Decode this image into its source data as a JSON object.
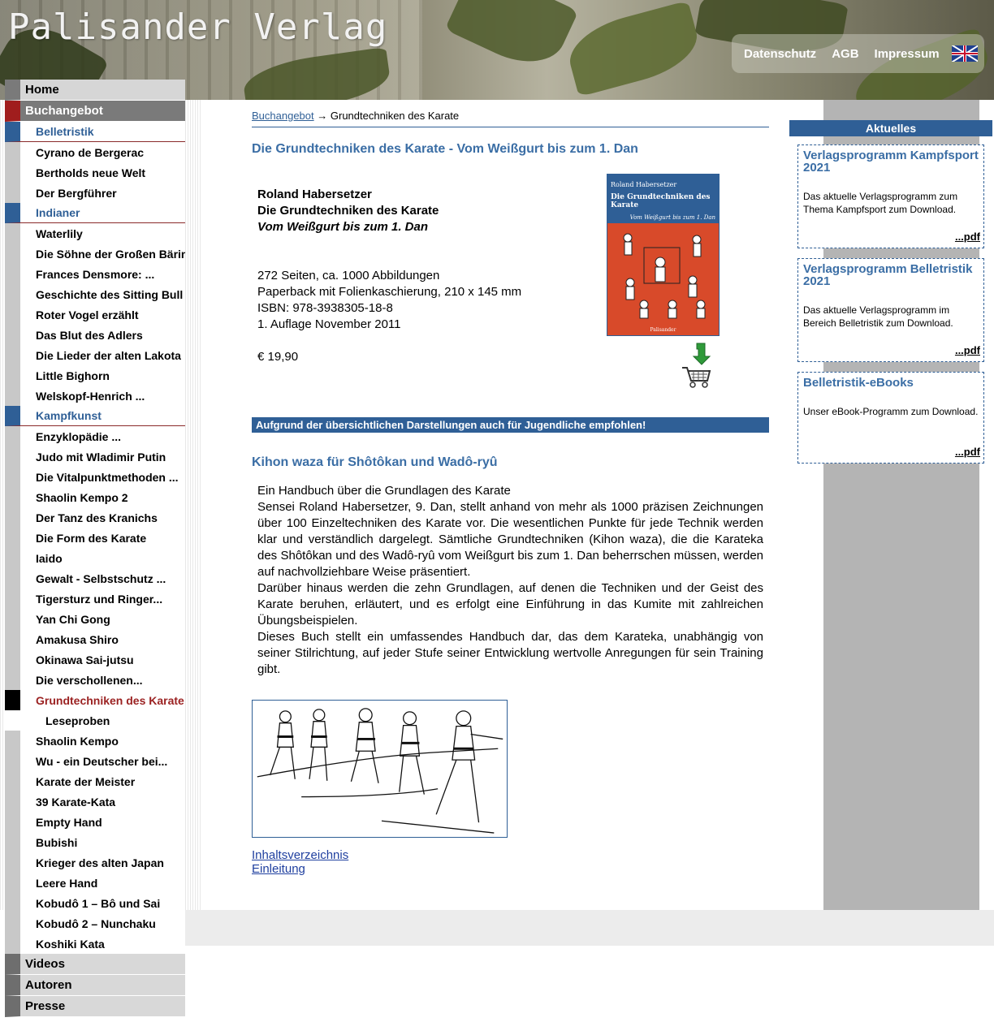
{
  "header": {
    "site_title": "Palisander Verlag",
    "links": [
      "Datenschutz",
      "AGB",
      "Impressum"
    ],
    "language_icon": "uk-flag-icon"
  },
  "nav": {
    "home": "Home",
    "buchangebot": "Buchangebot",
    "categories": {
      "belletristik": {
        "label": "Belletristik",
        "items": [
          "Cyrano de Bergerac",
          "Bertholds neue Welt",
          "Der Bergführer"
        ]
      },
      "indianer": {
        "label": "Indianer",
        "items": [
          "Waterlily",
          "Die Söhne der Großen Bärin",
          "Frances Densmore: ...",
          "Geschichte des Sitting Bull",
          "Roter Vogel erzählt",
          "Das Blut des Adlers",
          "Die Lieder der alten Lakota",
          "Little Bighorn",
          "Welskopf-Henrich ..."
        ]
      },
      "kampfkunst": {
        "label": "Kampfkunst",
        "items_before": [
          "Enzyklopädie ...",
          "Judo mit Wladimir Putin",
          "Die Vitalpunktmethoden ...",
          "Shaolin Kempo 2",
          "Der Tanz des Kranichs",
          "Die Form des Karate",
          "Iaido",
          "Gewalt - Selbstschutz ...",
          "Tigersturz und Ringer...",
          "Yan Chi Gong",
          "Amakusa Shiro",
          "Okinawa Sai-jutsu",
          "Die verschollenen..."
        ],
        "current": "Grundtechniken des Karate",
        "sub": "Leseproben",
        "items_after": [
          "Shaolin Kempo",
          "Wu - ein Deutscher bei...",
          "Karate der Meister",
          "39 Karate-Kata",
          "Empty Hand",
          "Bubishi",
          "Krieger des alten Japan",
          "Leere Hand",
          "Kobudô 1 – Bô und Sai",
          "Kobudô 2 – Nunchaku",
          "Koshiki Kata"
        ]
      }
    },
    "bottom": [
      "Videos",
      "Autoren",
      "Presse"
    ]
  },
  "breadcrumb": {
    "link": "Buchangebot",
    "separator": "→",
    "current": "Grundtechniken des Karate"
  },
  "book": {
    "heading": "Die Grundtechniken des Karate - Vom Weißgurt bis zum 1. Dan",
    "author": "Roland Habersetzer",
    "title": "Die Grundtechniken des Karate",
    "subtitle": "Vom Weißgurt bis zum 1. Dan",
    "pages": "272 Seiten, ca. 1000 Abbildungen",
    "binding": "Paperback mit Folienkaschierung, 210 x 145 mm",
    "isbn": "ISBN: 978-3938305-18-8",
    "edition": "1. Auflage November 2011",
    "price": "€ 19,90",
    "cover_author": "Roland Habersetzer",
    "cover_title": "Die Grundtechniken des Karate",
    "cover_subtitle": "Vom Weißgurt bis zum 1. Dan",
    "cover_publisher": "Palisander"
  },
  "banner": "Aufgrund der übersichtlichen Darstellungen auch für Jugendliche empfohlen!",
  "section_title": "Kihon waza für Shôtôkan und Wadô-ryû",
  "description": [
    "Ein Handbuch über die Grundlagen des Karate",
    "Sensei Roland Habersetzer, 9. Dan, stellt anhand von mehr als 1000 präzisen Zeichnungen über 100 Einzeltechniken des Karate vor. Die wesentlichen Punkte für jede Technik werden klar und verständlich dargelegt. Sämtliche Grundtechniken (Kihon waza), die die Karateka des Shôtôkan und des Wadô-ryû vom Weißgurt bis zum 1. Dan beherrschen müssen, werden auf nachvollziehbare Weise präsentiert.",
    "Darüber hinaus werden die zehn Grundlagen, auf denen die Techniken und der Geist des Karate beruhen, erläutert, und es erfolgt eine Einführung in das Kumite mit zahlreichen Übungsbeispielen.",
    "Dieses Buch stellt ein umfassendes Handbuch dar, das dem Karateka, unabhängig von seiner Stilrichtung, auf jeder Stufe seiner Entwicklung wertvolle Anregungen für sein Training gibt."
  ],
  "links": [
    "Inhaltsverzeichnis",
    "Einleitung"
  ],
  "aktuelles": {
    "heading": "Aktuelles",
    "items": [
      {
        "title": "Verlagsprogramm Kampfsport 2021",
        "text": "Das aktuelle Verlagsprogramm zum Thema Kampfsport zum Download.",
        "link": "...pdf"
      },
      {
        "title": "Verlagsprogramm Belletristik 2021",
        "text": "Das aktuelle Verlagsprogramm im Bereich Belletristik zum Download.",
        "link": "...pdf"
      },
      {
        "title": "Belletristik-eBooks",
        "text": "Unser eBook-Programm zum Download.",
        "link": "...pdf"
      }
    ]
  }
}
